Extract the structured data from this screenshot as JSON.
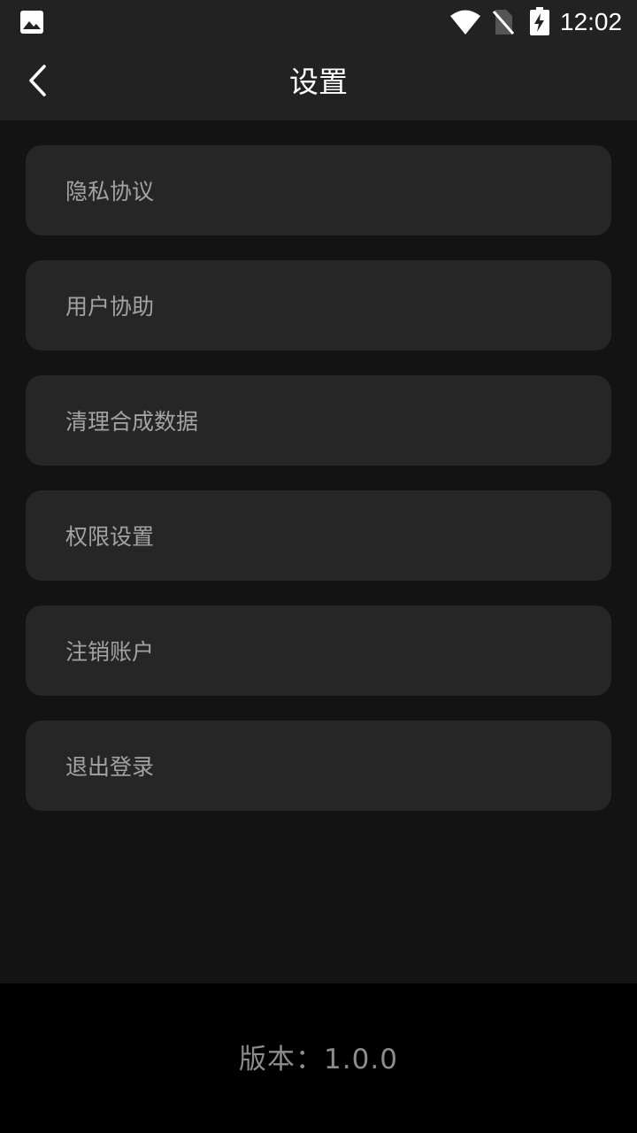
{
  "status_bar": {
    "time": "12:02",
    "icons": [
      "gallery-icon",
      "wifi-icon",
      "no-sim-icon",
      "battery-charging-icon"
    ]
  },
  "header": {
    "back_icon": "chevron-left-icon",
    "title": "设置"
  },
  "settings": {
    "items": [
      {
        "label": "隐私协议"
      },
      {
        "label": "用户协助"
      },
      {
        "label": "清理合成数据"
      },
      {
        "label": "权限设置"
      },
      {
        "label": "注销账户"
      },
      {
        "label": "退出登录"
      }
    ]
  },
  "footer": {
    "version": "版本：1.0.0"
  },
  "colors": {
    "background": "#131313",
    "bar": "#222222",
    "card": "#262626",
    "card_text": "#a3a3a3",
    "footer": "#000000",
    "version_text": "#8c8c8c"
  }
}
